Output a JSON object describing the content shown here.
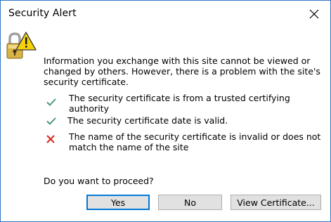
{
  "dialog": {
    "title": "Security Alert",
    "icon": "lock-warning-icon",
    "close_icon": "close-icon"
  },
  "message": "Information you exchange with this site cannot be viewed or changed by others. However, there is a problem with the site's security certificate.",
  "checks": [
    {
      "status": "ok",
      "icon": "green-check-icon",
      "text": "The security certificate is from a trusted certifying authority"
    },
    {
      "status": "ok",
      "icon": "green-check-icon",
      "text": "The security certificate date is valid."
    },
    {
      "status": "error",
      "icon": "red-x-icon",
      "text": "The name of the security certificate is invalid or does not match the name of the site"
    }
  ],
  "question": "Do you want to proceed?",
  "buttons": {
    "yes": "Yes",
    "no": "No",
    "view_certificate": "View Certificate..."
  },
  "colors": {
    "ok": "#4a9a78",
    "error": "#d93025",
    "default_button_border": "#0078d7",
    "warning_yellow": "#f5d20a"
  }
}
